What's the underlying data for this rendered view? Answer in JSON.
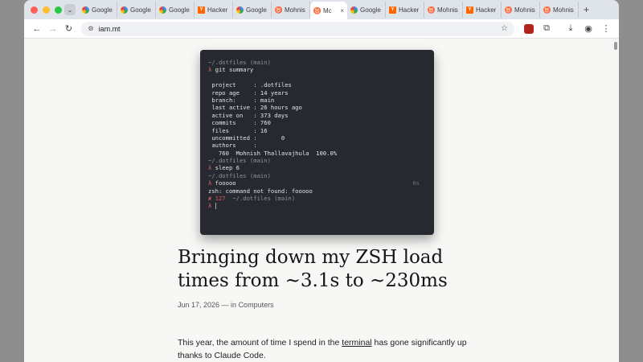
{
  "browser": {
    "tabs": [
      {
        "label": "Google",
        "favicon": "google-icon"
      },
      {
        "label": "Google",
        "favicon": "google-icon"
      },
      {
        "label": "Google",
        "favicon": "google-icon"
      },
      {
        "label": "Hacker",
        "favicon": "hacker-news-icon"
      },
      {
        "label": "Google",
        "favicon": "google-icon"
      },
      {
        "label": "Mohnis",
        "favicon": "bull-icon"
      },
      {
        "label": "Mc",
        "favicon": "bull-icon",
        "active": true
      },
      {
        "label": "Google",
        "favicon": "google-icon"
      },
      {
        "label": "Hacker",
        "favicon": "hacker-news-icon"
      },
      {
        "label": "Mohnis",
        "favicon": "bull-icon"
      },
      {
        "label": "Hacker",
        "favicon": "hacker-news-icon"
      },
      {
        "label": "Mohnis",
        "favicon": "bull-icon"
      },
      {
        "label": "Mohnis",
        "favicon": "bull-icon"
      }
    ],
    "new_tab_label": "+",
    "url": "iam.mt"
  },
  "terminal": {
    "lines": [
      {
        "cls": "dim",
        "text": "~/.dotfiles (main)"
      },
      {
        "cls": "",
        "prompt": "λ",
        "text": "git summary"
      },
      {
        "cls": "",
        "text": ""
      },
      {
        "cls": "",
        "text": " project     : .dotfiles"
      },
      {
        "cls": "",
        "text": " repo age    : 14 years"
      },
      {
        "cls": "",
        "text": " branch:     : main"
      },
      {
        "cls": "",
        "text": " last active : 26 hours ago"
      },
      {
        "cls": "",
        "text": " active on   : 373 days"
      },
      {
        "cls": "",
        "text": " commits     : 760"
      },
      {
        "cls": "",
        "text": " files       : 16"
      },
      {
        "cls": "",
        "text": " uncommitted :       0"
      },
      {
        "cls": "",
        "text": " authors     :"
      },
      {
        "cls": "",
        "text": "   760  Mohnish Thallavajhula  100.0%"
      },
      {
        "cls": "dim",
        "text": "~/.dotfiles (main)"
      },
      {
        "cls": "",
        "prompt": "λ",
        "text": "sleep 6"
      },
      {
        "cls": "dim",
        "text": "~/.dotfiles (main)"
      },
      {
        "cls": "",
        "prompt": "λ",
        "text": "fooooo",
        "timer": "6s"
      },
      {
        "cls": "",
        "text": "zsh: command not found: fooooo"
      },
      {
        "cls": "",
        "exit": "✘ 127",
        "text": "~/.dotfiles (main)"
      },
      {
        "cls": "",
        "prompt": "λ",
        "text": "",
        "cursor": true
      }
    ]
  },
  "article": {
    "title": "Bringing down my ZSH load times from ~3.1s to ~230ms",
    "date": "Jun 17, 2026",
    "meta_sep": " — in ",
    "category": "Computers",
    "body_before": "This year, the amount of time I spend in the ",
    "body_link": "terminal",
    "body_after": " has gone significantly up thanks to Claude Code."
  }
}
